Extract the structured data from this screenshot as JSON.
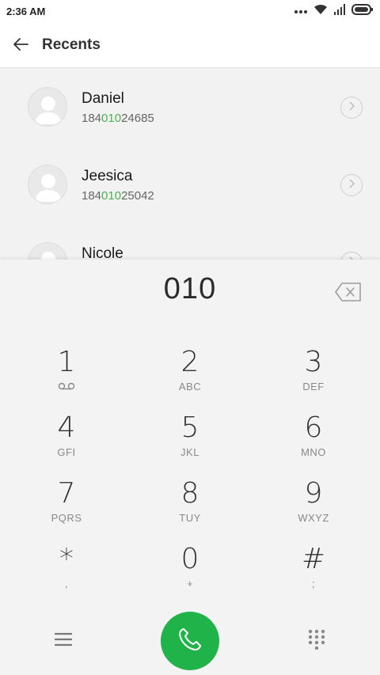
{
  "status_bar": {
    "time": "2:36 AM",
    "icons": [
      "more-dots-icon",
      "wifi-icon",
      "signal-icon",
      "battery-icon"
    ]
  },
  "app_bar": {
    "title": "Recents",
    "back_icon": "arrow-left-icon"
  },
  "recents": [
    {
      "name": "Daniel",
      "number_prefix": "184",
      "number_match": "010",
      "number_suffix": "24685"
    },
    {
      "name": "Jeesica",
      "number_prefix": "184",
      "number_match": "010",
      "number_suffix": "25042"
    },
    {
      "name": "Nicole",
      "number_prefix": "",
      "number_match": "",
      "number_suffix": ""
    }
  ],
  "dialer": {
    "input": "010",
    "backspace_icon": "backspace-icon",
    "keys": [
      {
        "digit": "1",
        "letters": ""
      },
      {
        "digit": "2",
        "letters": "ABC"
      },
      {
        "digit": "3",
        "letters": "DEF"
      },
      {
        "digit": "4",
        "letters": "GFI"
      },
      {
        "digit": "5",
        "letters": "JKL"
      },
      {
        "digit": "6",
        "letters": "MNO"
      },
      {
        "digit": "7",
        "letters": "PQRS"
      },
      {
        "digit": "8",
        "letters": "TUY"
      },
      {
        "digit": "9",
        "letters": "WXYZ"
      },
      {
        "digit": "*",
        "letters": ","
      },
      {
        "digit": "0",
        "letters": "+"
      },
      {
        "digit": "#",
        "letters": ";"
      }
    ]
  },
  "bottom_bar": {
    "menu_icon": "menu-icon",
    "call_icon": "phone-icon",
    "keypad_icon": "keypad-icon"
  },
  "colors": {
    "accent_green": "#1fb34a",
    "match_highlight": "#4caf50"
  }
}
